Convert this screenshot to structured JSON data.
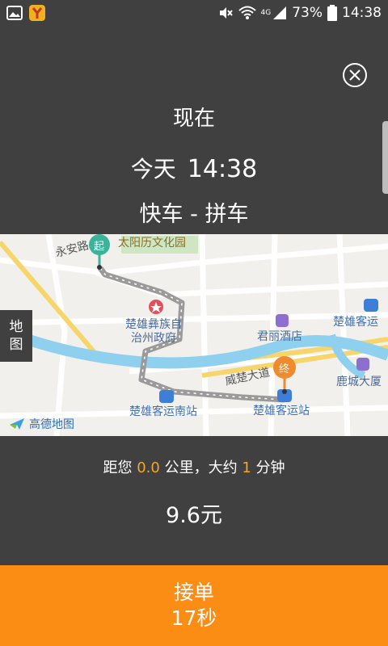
{
  "status_bar": {
    "signal_label": "4G",
    "battery": "73%",
    "time": "14:38"
  },
  "header": {
    "when_label": "现在",
    "day_label": "今天",
    "time_value": "14:38",
    "ride_type": "快车 - 拼车"
  },
  "map": {
    "start_marker": "起",
    "end_marker": "终",
    "labels": {
      "road_yongan": "永安路",
      "park": "太阳历文化园",
      "gov_line1": "楚雄彝族自",
      "gov_line2": "治州政府",
      "hotel": "君丽酒店",
      "bus_station_ne": "楚雄客运",
      "road_weichu": "威楚大道",
      "mall": "鹿城大厦",
      "south_station": "楚雄客运南站",
      "bus_station": "楚雄客运站",
      "brand": "高德地图"
    },
    "toggle_line1": "地",
    "toggle_line2": "图"
  },
  "trip": {
    "prefix": "距您",
    "distance": "0.0",
    "unit_text": "公里，大约",
    "minutes": "1",
    "suffix": "分钟",
    "price": "9.6元"
  },
  "action": {
    "label": "接单",
    "countdown": "17秒"
  },
  "colors": {
    "background": "#404040",
    "accent": "#fb8c14",
    "highlight": "#f5a623",
    "start_pin": "#3bb39a",
    "end_pin": "#f08a2e"
  }
}
